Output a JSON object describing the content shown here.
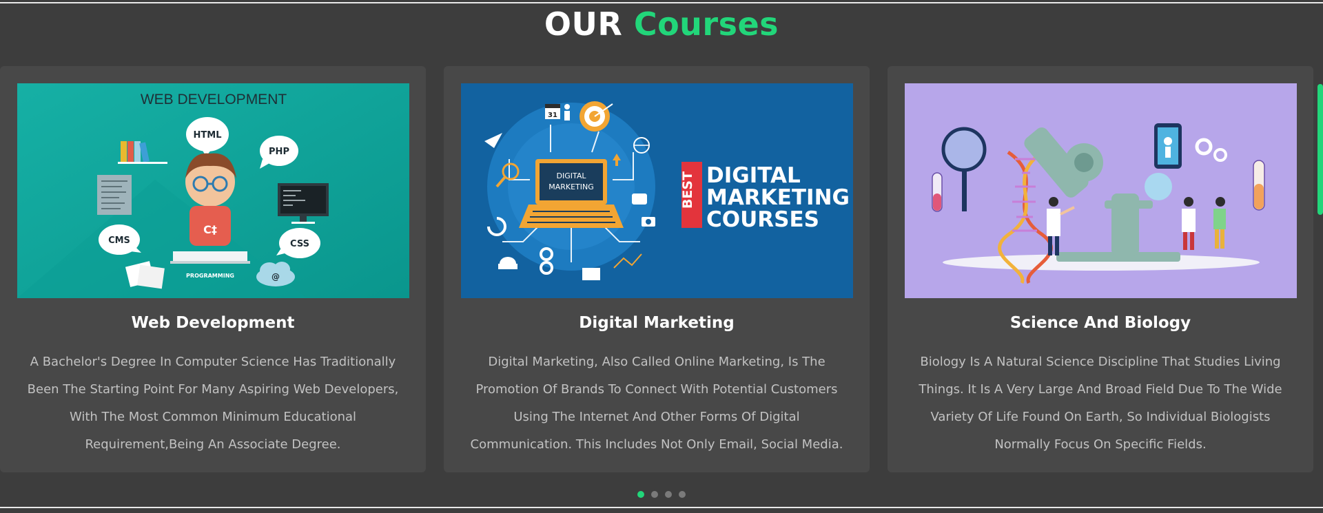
{
  "heading": {
    "word1": "OUR",
    "word2": "Courses"
  },
  "colors": {
    "background": "#3d3d3d",
    "card": "#484848",
    "accent": "#22d67a",
    "text": "#c2c2c2"
  },
  "courses": [
    {
      "title": "Web Development",
      "description": "A Bachelor's Degree In Computer Science Has Traditionally Been The Starting Point For Many Aspiring Web Developers, With The Most Common Minimum Educational Requirement,Being An Associate Degree.",
      "image": {
        "banner": "WEB DEVELOPMENT",
        "bubbles": [
          "HTML",
          "PHP",
          "CMS",
          "CSS"
        ],
        "shirt": "C‡",
        "caption": "PROGRAMMING",
        "cloud_symbol": "@"
      }
    },
    {
      "title": "Digital Marketing",
      "description": "Digital Marketing, Also Called Online Marketing, Is The Promotion Of Brands To Connect With Potential Customers Using The Internet And Other Forms Of Digital Communication. This Includes Not Only Email, Social Media.",
      "image": {
        "calendar_day": "31",
        "screen_text": [
          "DIGITAL",
          "MARKETING"
        ],
        "badge": "BEST",
        "headline": [
          "DIGITAL",
          "MARKETING",
          "COURSES"
        ]
      }
    },
    {
      "title": "Science And Biology",
      "description": "Biology Is A Natural Science Discipline That Studies Living Things. It Is A Very Large And Broad Field Due To The Wide Variety Of Life Found On Earth, So Individual Biologists Normally Focus On Specific Fields.",
      "image": {}
    }
  ],
  "carousel": {
    "dot_count": 4,
    "active_index": 0
  }
}
